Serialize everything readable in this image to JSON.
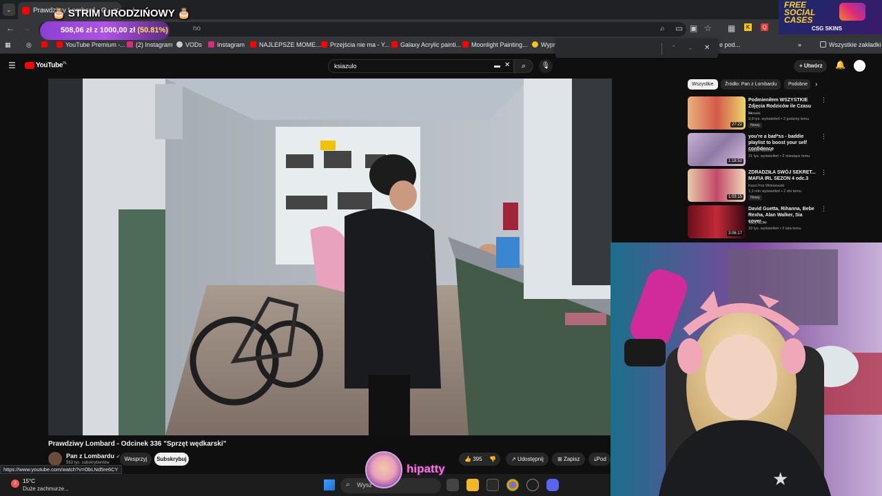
{
  "browser": {
    "tab_title": "Prawdziwy Lombard - O...",
    "url_partial": "no",
    "bookmarks": [
      {
        "label": "YouTube Premium -...",
        "color": "#ff0000"
      },
      {
        "label": "(2) Instagram",
        "color": "#dd2a7b"
      },
      {
        "label": "VODs",
        "color": "#cccccc"
      },
      {
        "label": "Instagram",
        "color": "#dd2a7b"
      },
      {
        "label": "NAJLEPSZE MOME...",
        "color": "#ff0000"
      },
      {
        "label": "Przejścia nie ma - Y...",
        "color": "#ff0000"
      },
      {
        "label": "Galaxy Acrylic painti...",
        "color": "#ff0000"
      },
      {
        "label": "Moonlight Painting...",
        "color": "#ff0000"
      },
      {
        "label": "Wypr",
        "color": "#f5c518"
      },
      {
        "label": "e pod...",
        "color": "#35363a"
      }
    ],
    "all_bookmarks": "Wszystkie zakładki",
    "status_url": "https://www.youtube.com/watch?v=ObLNd5re6CY"
  },
  "overlay": {
    "stream_title": "STRIM URODZIŃOWY",
    "goal_amount": "508,06 zł z 1000,00 zł",
    "goal_percent": "(50.81%)",
    "sponsor_line1": "FREE",
    "sponsor_line2": "SOCIAL",
    "sponsor_line3": "CASES",
    "sponsor_sub": "CSG SKINS",
    "streamer_name": "hipatty"
  },
  "youtube": {
    "logo": "YouTube",
    "logo_country": "PL",
    "search_value": "ksiazulo",
    "create_label": "Utwórz",
    "video_title": "Prawdziwy Lombard - Odcinek 336 \"Sprzęt wędkarski\"",
    "channel_name": "Pan z Lombardu",
    "channel_subs": "563 tys. subskrybentów",
    "support_label": "Wesprzyj",
    "subscribe_label": "Subskrybuj",
    "likes": "395",
    "share_label": "Udostępnij",
    "save_label": "Zapisz",
    "more_label": "Pod",
    "chips": [
      "Wszystkie",
      "Źródło: Pan z Lombardu",
      "Podobne"
    ],
    "recommendations": [
      {
        "title": "Podmieniłem WSZYSTKIE Zdjęcia Rodziców ile Czasu ...",
        "channel": "Blowek",
        "meta": "3,9 tys. wyświetleń • 2 godziny temu",
        "badge": "Nowy",
        "duration": "27:22"
      },
      {
        "title": "you're a bad*ss - baddie playlist to boost your self confidence",
        "channel": "baddie femme",
        "meta": "21 tys. wyświetleń • 2 miesiące temu",
        "badge": "",
        "duration": "1:18:52"
      },
      {
        "title": "ZDRADZIŁA SWÓJ SEKRET... MAFIA IRL SEZON 4 odc.3",
        "channel": "Karol Friz Wiśniewski",
        "meta": "1,2 mln wyświetleń • 2 dni temu",
        "badge": "Nowy",
        "duration": "1:03:15"
      },
      {
        "title": "David Guetta, Rihanna, Bebe Rexha, Alan Walker, Sia cover ...",
        "channel": "Tasty EDM",
        "meta": "33 tys. wyświetleń • 2 lata temu",
        "badge": "",
        "duration": "3:06:17"
      }
    ]
  },
  "taskbar": {
    "temperature": "15°C",
    "weather": "Duże zachmurze...",
    "search_placeholder": "Wysz"
  }
}
